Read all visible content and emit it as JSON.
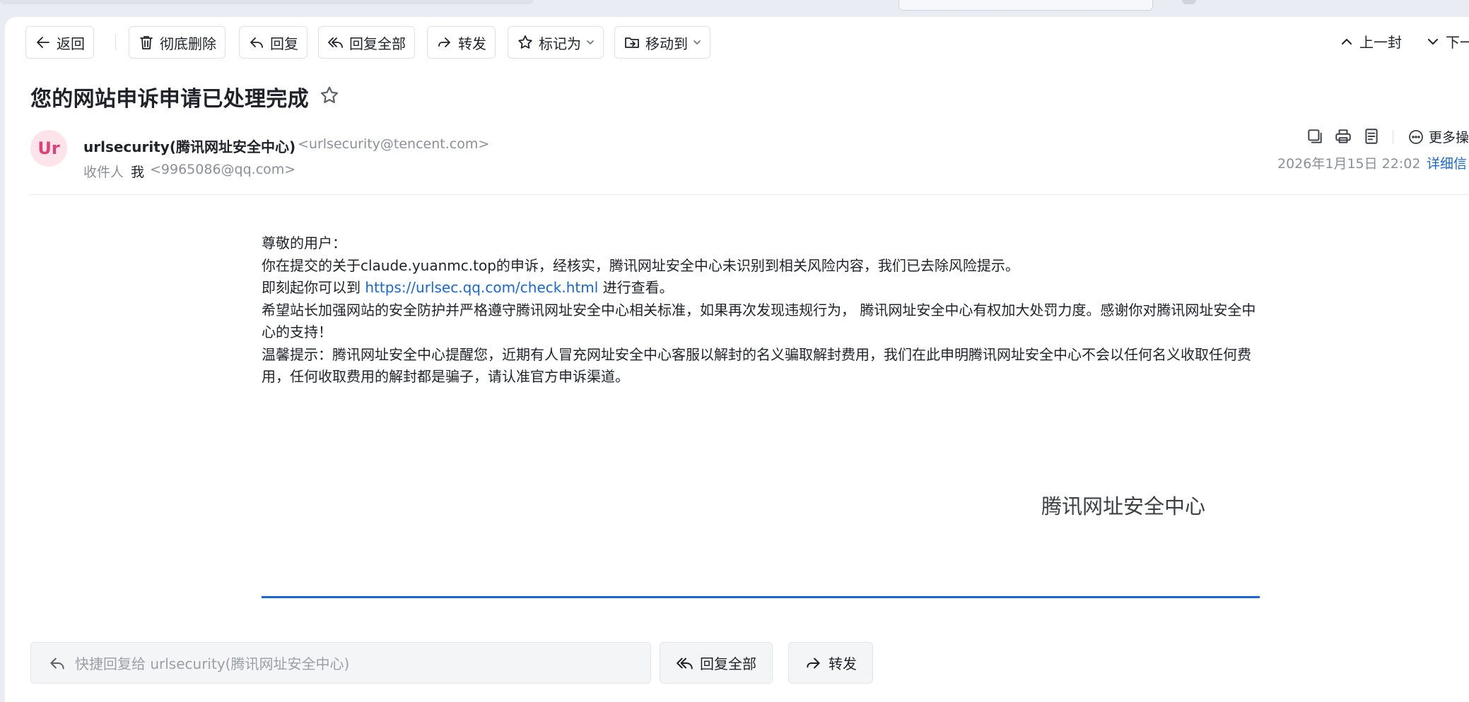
{
  "toolbar": {
    "back": "返回",
    "delete_forever": "彻底删除",
    "reply": "回复",
    "reply_all": "回复全部",
    "forward": "转发",
    "mark_as": "标记为",
    "move_to": "移动到",
    "prev": "上一封",
    "next": "下一"
  },
  "email": {
    "subject": "您的网站申诉申请已处理完成",
    "avatar_initials": "Ur",
    "sender_name": "urlsecurity(腾讯网址安全中心)",
    "sender_email": "<urlsecurity@tencent.com>",
    "recipient_label": "收件人",
    "recipient_name": "我",
    "recipient_email": "<9965086@qq.com>",
    "date": "2026年1月15日 22:02",
    "details": "详细信",
    "more_ops": "更多操",
    "body": {
      "greeting": "尊敬的用户：",
      "line1": "你在提交的关于claude.yuanmc.top的申诉，经核实，腾讯网址安全中心未识别到相关风险内容，我们已去除风险提示。",
      "line2_pre": "即刻起你可以到 ",
      "line2_link": "https://urlsec.qq.com/check.html",
      "line2_post": " 进行查看。",
      "line3": "希望站长加强网站的安全防护并严格遵守腾讯网址安全中心相关标准，如果再次发现违规行为， 腾讯网址安全中心有权加大处罚力度。感谢你对腾讯网址安全中心的支持！",
      "line4": "温馨提示：腾讯网址安全中心提醒您，近期有人冒充网址安全中心客服以解封的名义骗取解封费用，我们在此申明腾讯网址安全中心不会以任何名义收取任何费用，任何收取费用的解封都是骗子，请认准官方申诉渠道。",
      "signature": "腾讯网址安全中心"
    }
  },
  "bottom": {
    "quick_reply_placeholder": "快捷回复给 urlsecurity(腾讯网址安全中心)",
    "reply_all": "回复全部",
    "forward": "转发"
  },
  "colors": {
    "accent": "#1a66d6",
    "avatar_bg": "#fde4ea",
    "avatar_text": "#e0407a"
  }
}
